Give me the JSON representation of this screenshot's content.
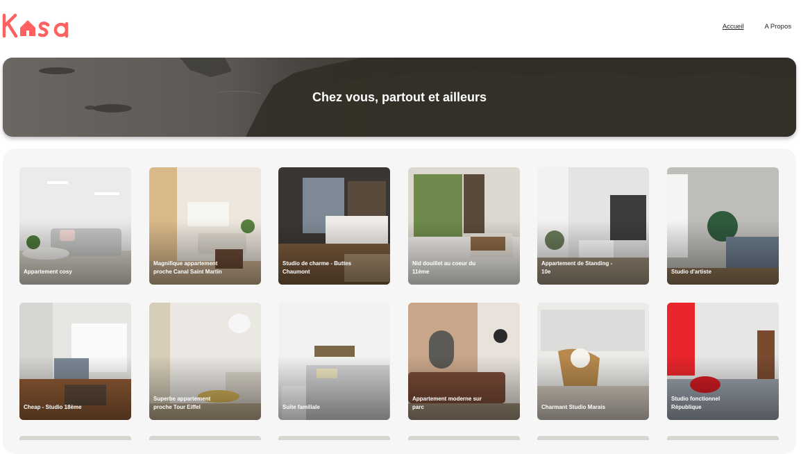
{
  "brand": {
    "name": "Kasa",
    "color": "#FF6060"
  },
  "nav": [
    {
      "label": "Accueil",
      "active": true
    },
    {
      "label": "A Propos",
      "active": false
    }
  ],
  "hero": {
    "title": "Chez vous, partout et ailleurs"
  },
  "listings": [
    {
      "title": "Appartement cosy",
      "scheme": "light"
    },
    {
      "title": "Magnifique appartement proche Canal Saint Martin",
      "scheme": "warm"
    },
    {
      "title": "Studio de charme - Buttes Chaumont",
      "scheme": "dark"
    },
    {
      "title": "Nid douillet au coeur du 11ème",
      "scheme": "green"
    },
    {
      "title": "Appartement de Standing - 10e",
      "scheme": "grey"
    },
    {
      "title": "Studio d'artiste",
      "scheme": "concrete"
    },
    {
      "title": "Cheap - Studio 18ème",
      "scheme": "wood"
    },
    {
      "title": "Superbe appartement proche Tour Eiffel",
      "scheme": "beige"
    },
    {
      "title": "Suite familiale",
      "scheme": "white"
    },
    {
      "title": "Appartement moderne sur parc",
      "scheme": "brick"
    },
    {
      "title": "Charmant Studio Marais",
      "scheme": "rattan"
    },
    {
      "title": "Studio fonctionnel République",
      "scheme": "red"
    }
  ]
}
